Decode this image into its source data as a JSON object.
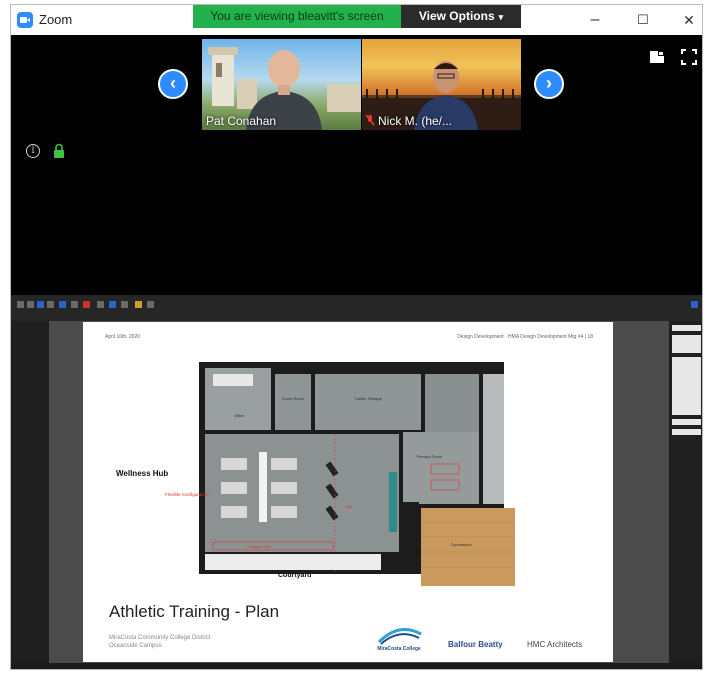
{
  "window": {
    "app_name": "Zoom",
    "share_banner": "You are viewing bleavitt's screen",
    "view_options": "View Options",
    "controls": {
      "minimize": "–",
      "maximize": "☐",
      "close": "✕"
    }
  },
  "participants": [
    {
      "name": "Pat Conahan"
    },
    {
      "name": "Nick M. (he/..."
    }
  ],
  "icons": {
    "prev": "prev-arrow-icon",
    "next": "next-arrow-icon",
    "info": "info-icon",
    "lock": "lock-icon",
    "speaker_view": "speaker-view-icon",
    "fullscreen": "fullscreen-icon",
    "muted": "muted-mic-icon"
  },
  "colors": {
    "zoom_blue": "#2d8cff",
    "banner_green": "#23b14d",
    "lock_green": "#3ec43e"
  },
  "slide": {
    "date": "April 16th, 2020",
    "header": "Design Development · HMA Design Development Mtg #4 | 18",
    "wellness_hub": "Wellness Hub",
    "flexible_config": "Flexible Configuration",
    "courtyard": "Courtyard",
    "title": "Athletic Training - Plan",
    "district_line1": "MiraCosta Community College District",
    "district_line2": "Oceanside Campus",
    "logo_miracosta": "MiraCosta College",
    "logo_balfour": "Balfour Beatty",
    "logo_hmc": "HMC Architects"
  },
  "rooms": {
    "office": "Office",
    "exam": "Exam Room",
    "storage": "Trainer Storage",
    "therapy": "Therapy Room",
    "gymnasium": "Gymnasium",
    "casework": "Casework Sink",
    "slab": "Slab"
  }
}
